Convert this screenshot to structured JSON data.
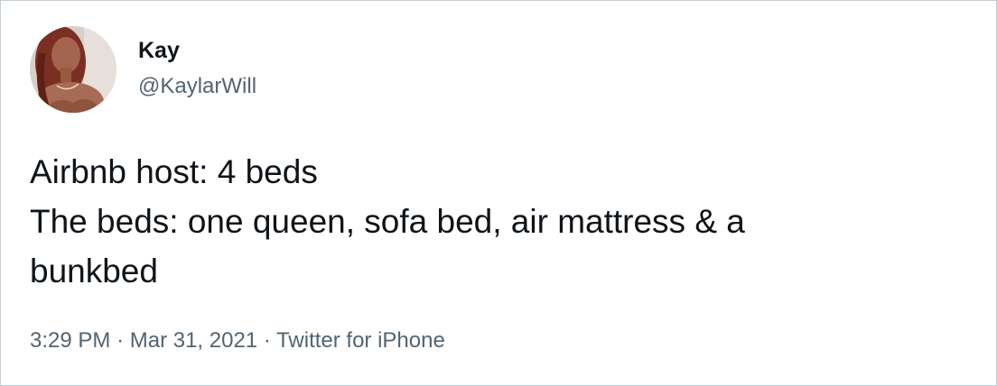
{
  "author": {
    "display_name": "Kay",
    "handle": "@KaylarWill",
    "avatar_alt": "Kay"
  },
  "tweet": {
    "lines": [
      "Airbnb host: 4 beds",
      "The beds: one queen, sofa bed, air mattress & a",
      "bunkbed"
    ]
  },
  "meta": {
    "time": "3:29 PM",
    "separator": "·",
    "date": "Mar 31, 2021",
    "source": "Twitter for iPhone"
  },
  "colors": {
    "text_primary": "#0f1419",
    "text_secondary": "#536471",
    "border": "#c4cfd6"
  }
}
